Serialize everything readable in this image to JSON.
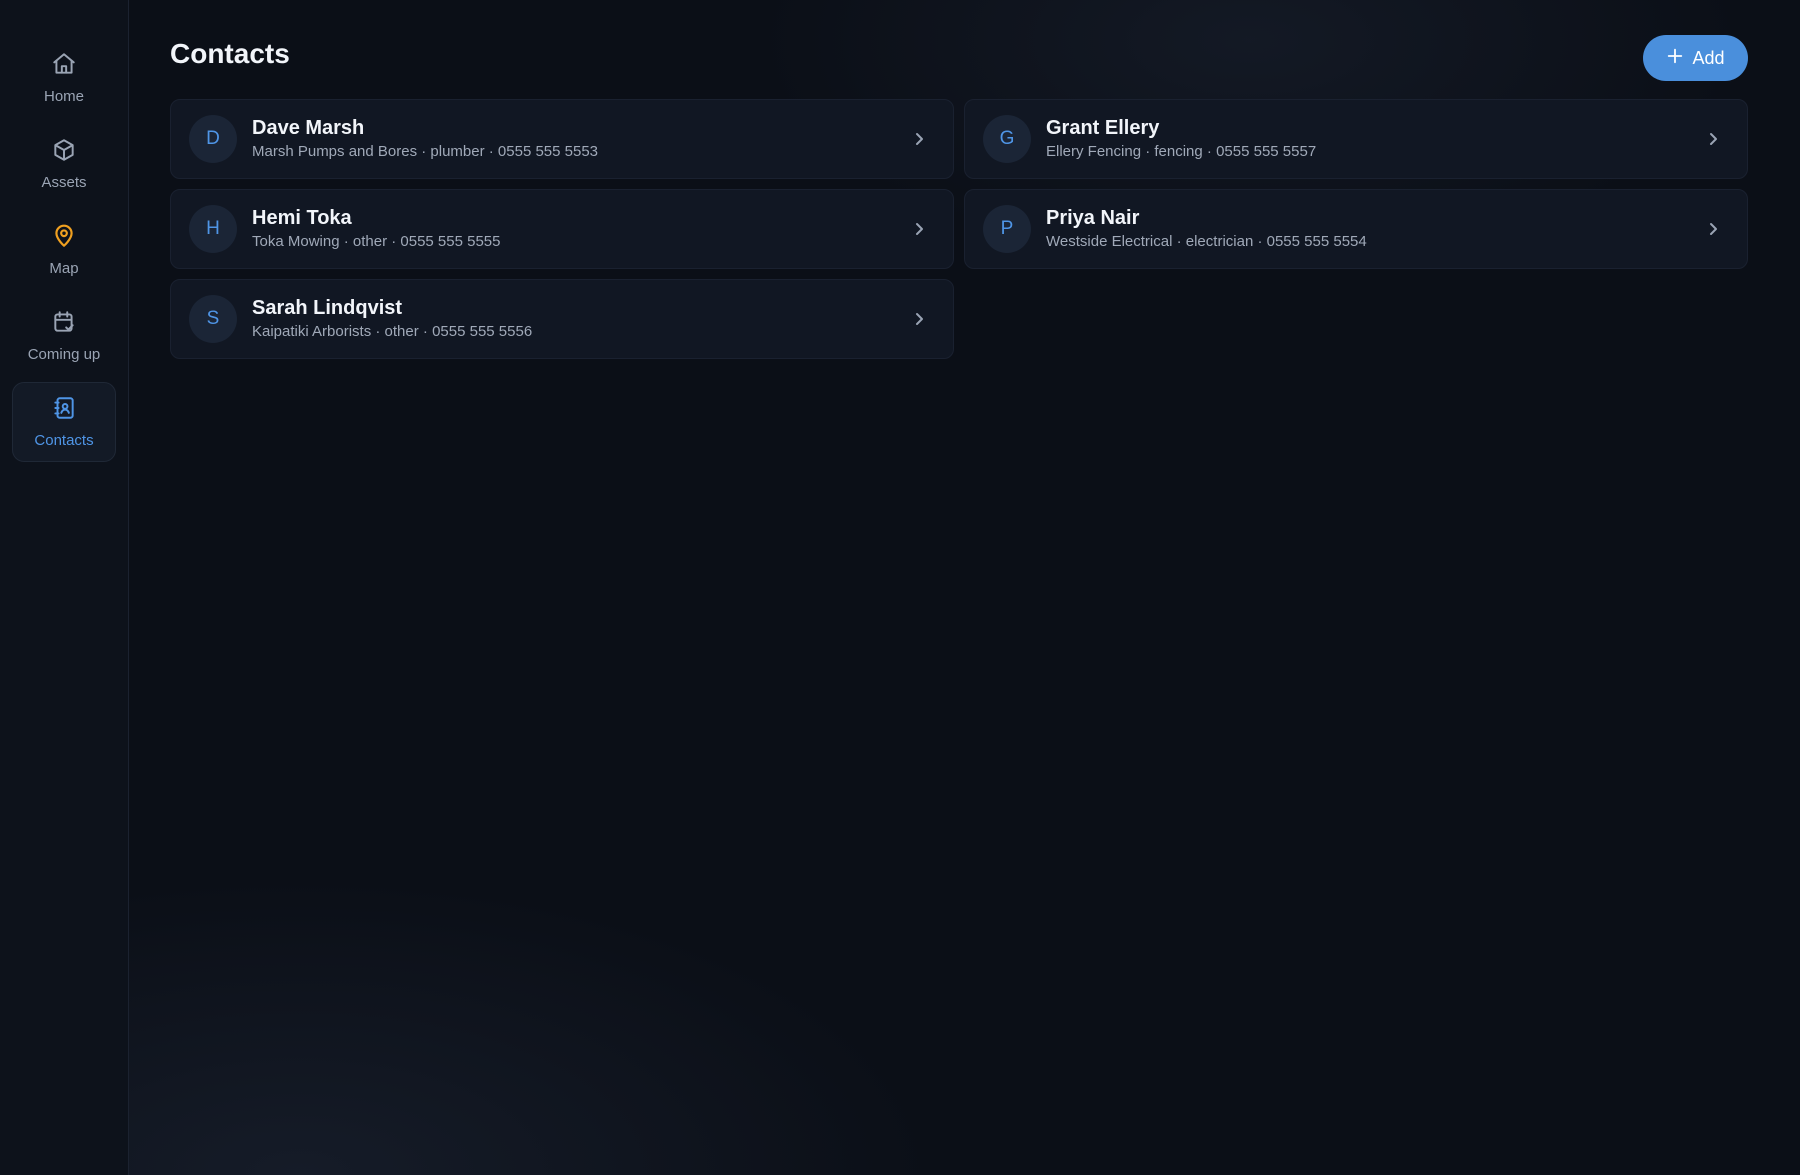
{
  "nav": {
    "items": [
      {
        "label": "Home",
        "icon": "home-icon"
      },
      {
        "label": "Assets",
        "icon": "cube-icon"
      },
      {
        "label": "Map",
        "icon": "map-pin-icon"
      },
      {
        "label": "Coming up",
        "icon": "calendar-check-icon"
      },
      {
        "label": "Contacts",
        "icon": "contact-book-icon",
        "active": true
      }
    ]
  },
  "header": {
    "title": "Contacts",
    "add_label": "Add"
  },
  "contacts": [
    {
      "initial": "D",
      "name": "Dave Marsh",
      "details": "Marsh Pumps and Bores · plumber · 0555 555 5553"
    },
    {
      "initial": "G",
      "name": "Grant Ellery",
      "details": "Ellery Fencing · fencing · 0555 555 5557"
    },
    {
      "initial": "H",
      "name": "Hemi Toka",
      "details": "Toka Mowing · other · 0555 555 5555"
    },
    {
      "initial": "P",
      "name": "Priya Nair",
      "details": "Westside Electrical · electrician · 0555 555 5554"
    },
    {
      "initial": "S",
      "name": "Sarah Lindqvist",
      "details": "Kaipatiki Arborists · other · 0555 555 5556"
    }
  ],
  "colors": {
    "accent": "#4a8fdc",
    "map_icon": "#f0a020",
    "background": "#0b0f17",
    "card": "#111723"
  }
}
